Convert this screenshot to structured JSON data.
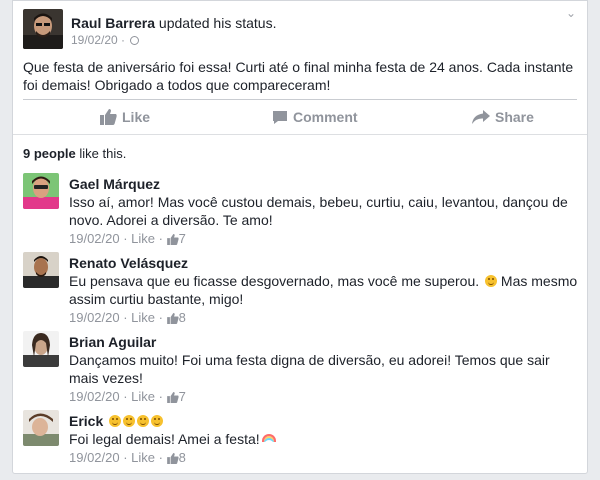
{
  "post": {
    "author": "Raul Barrera",
    "action": " updated his status.",
    "date": "19/02/20",
    "meta_sep": " · ",
    "privacy_icon": "globe-icon",
    "text": "Que festa de aniversário foi essa! Curti até o final minha festa de 24 anos. Cada instante foi demais! Obrigado a todos que compareceram!"
  },
  "actions": {
    "like": "Like",
    "comment": "Comment",
    "share": "Share"
  },
  "likes": {
    "count": "9 people",
    "suffix": " like this."
  },
  "comment_meta": {
    "sep": " · ",
    "like_label": "Like"
  },
  "comments": [
    {
      "name": "Gael Márquez",
      "text": "Isso aí, amor! Mas você custou demais, bebeu, curtiu, caiu, levantou, dançou de novo. Adorei a diversão. Te amo!",
      "date": "19/02/20",
      "likes": "7"
    },
    {
      "name": "Renato Velásquez",
      "text_a": "Eu pensava que eu ficasse desgovernado, mas você me superou. ",
      "text_b": " Mas mesmo assim curtiu bastante, migo!",
      "date": "19/02/20",
      "likes": "8"
    },
    {
      "name": "Brian Aguilar",
      "text": "Dançamos muito! Foi uma festa digna de diversão, eu adorei!  Temos que sair mais vezes!",
      "date": "19/02/20",
      "likes": "7"
    },
    {
      "name": "Erick",
      "text": "Foi legal demais! Amei a festa!",
      "date": "19/02/20",
      "likes": "8"
    }
  ],
  "colors": {
    "link_gray": "#90949c",
    "text": "#1d2129",
    "like_blue": "#4267b2"
  }
}
